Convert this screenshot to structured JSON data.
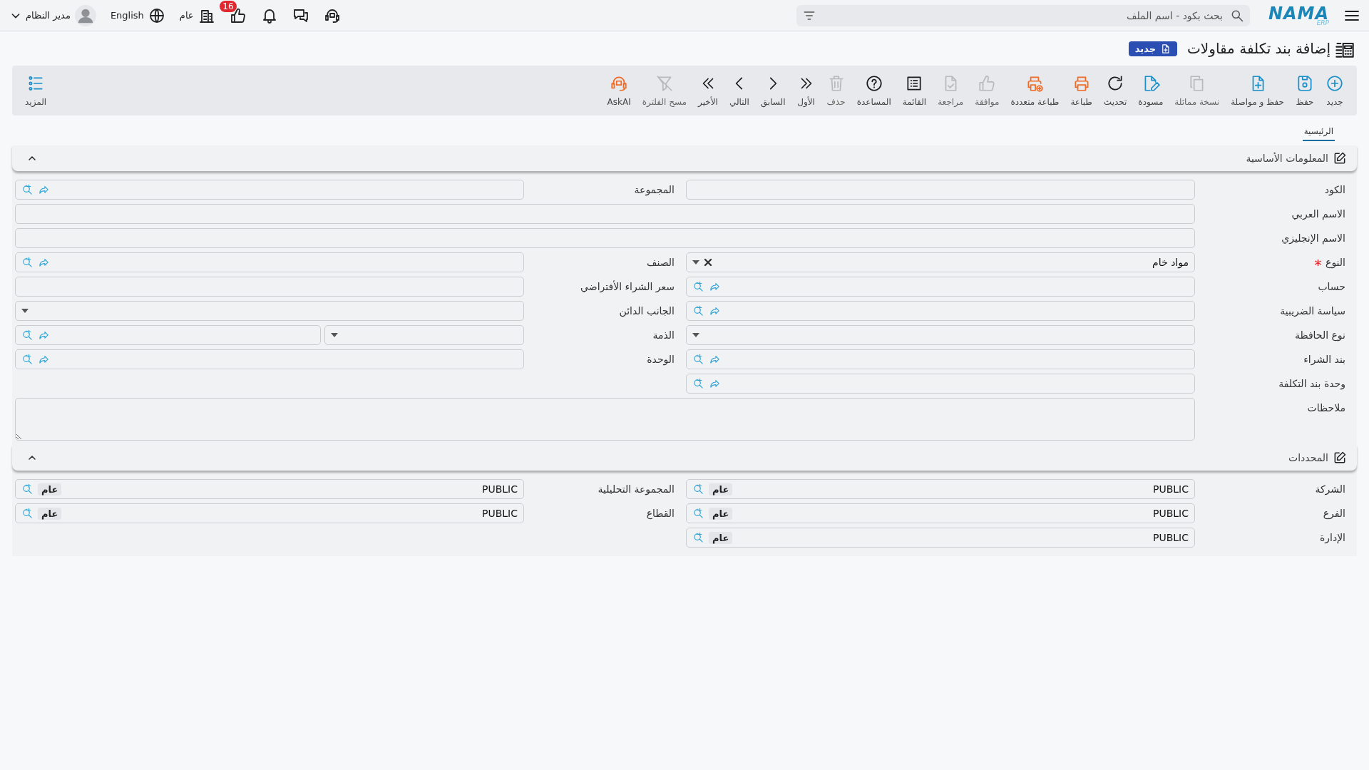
{
  "topbar": {
    "logo": {
      "name": "NAMA",
      "sub": "ERP"
    },
    "search": {
      "placeholder": "بحث بكود - اسم الملف"
    },
    "approvals_badge": "16",
    "scope": "عام",
    "language": "English",
    "user": "مدير النظام"
  },
  "page": {
    "title": "إضافة بند تكلفة مقاولات",
    "status": "جديد"
  },
  "toolbar": [
    {
      "label": "جديد",
      "kind": "new",
      "disabled": false
    },
    {
      "label": "حفظ",
      "kind": "save",
      "disabled": false
    },
    {
      "label": "حفظ و مواصلة",
      "kind": "save-continue",
      "disabled": false
    },
    {
      "label": "نسخة مماثلة",
      "kind": "copy",
      "disabled": true
    },
    {
      "label": "مسودة",
      "kind": "draft",
      "disabled": false
    },
    {
      "label": "تحديث",
      "kind": "refresh",
      "disabled": false
    },
    {
      "label": "طباعة",
      "kind": "print",
      "disabled": false
    },
    {
      "label": "طباعة متعددة",
      "kind": "multi-print",
      "disabled": false
    },
    {
      "label": "موافقة",
      "kind": "approve",
      "disabled": true
    },
    {
      "label": "مراجعة",
      "kind": "review",
      "disabled": true
    },
    {
      "label": "القائمة",
      "kind": "list",
      "disabled": false
    },
    {
      "label": "المساعدة",
      "kind": "help",
      "disabled": false
    },
    {
      "label": "حذف",
      "kind": "delete",
      "disabled": true
    },
    {
      "label": "الأول",
      "kind": "first",
      "disabled": false
    },
    {
      "label": "السابق",
      "kind": "prev",
      "disabled": false
    },
    {
      "label": "التالي",
      "kind": "next",
      "disabled": false
    },
    {
      "label": "الأخير",
      "kind": "last",
      "disabled": false
    },
    {
      "label": "مسح الفلترة",
      "kind": "clear-filter",
      "disabled": true
    },
    {
      "label": "AskAI",
      "kind": "askai",
      "disabled": false
    }
  ],
  "more": {
    "label": "المزيد"
  },
  "tabs": [
    {
      "label": "الرئيسية",
      "selected": true
    }
  ],
  "sections": [
    {
      "title": "المعلومات الأساسية",
      "expanded": true,
      "rows": [
        {
          "fields": [
            {
              "label": "الكود",
              "kind": "text",
              "required": false
            },
            {
              "label": "المجموعة",
              "kind": "lookup",
              "required": false
            }
          ]
        },
        {
          "fields": [
            {
              "label": "الاسم العربي",
              "kind": "wide",
              "required": false
            }
          ]
        },
        {
          "fields": [
            {
              "label": "الاسم الإنجليزي",
              "kind": "wide",
              "required": false
            }
          ]
        },
        {
          "fields": [
            {
              "label": "النوع",
              "kind": "select-clear",
              "value": "مواد خام",
              "required": true
            },
            {
              "label": "الصنف",
              "kind": "lookup",
              "required": false
            }
          ]
        },
        {
          "fields": [
            {
              "label": "حساب",
              "kind": "lookup",
              "required": false
            },
            {
              "label": "سعر الشراء الأفتراضي",
              "kind": "text",
              "required": false
            }
          ]
        },
        {
          "fields": [
            {
              "label": "سياسة الضريبية",
              "kind": "lookup",
              "required": false
            },
            {
              "label": "الجانب الدائن",
              "kind": "select",
              "required": false
            }
          ]
        },
        {
          "fields": [
            {
              "label": "نوع الحافظة",
              "kind": "select",
              "required": false
            },
            {
              "label": "الذمة",
              "kind": "split",
              "required": false
            }
          ]
        },
        {
          "fields": [
            {
              "label": "بند الشراء",
              "kind": "lookup",
              "required": false
            },
            {
              "label": "الوحدة",
              "kind": "lookup",
              "required": false
            }
          ]
        },
        {
          "fields": [
            {
              "label": "وحدة بند التكلفة",
              "kind": "lookup",
              "required": false
            }
          ]
        },
        {
          "fields": [
            {
              "label": "ملاحظات",
              "kind": "notes",
              "required": false
            }
          ]
        }
      ]
    },
    {
      "title": "المحددات",
      "expanded": true,
      "rows": [
        {
          "fields": [
            {
              "label": "الشركة",
              "kind": "public",
              "value": "PUBLIC",
              "tag": "عام",
              "required": false
            },
            {
              "label": "المجموعة التحليلية",
              "kind": "public",
              "value": "PUBLIC",
              "tag": "عام",
              "required": false
            }
          ]
        },
        {
          "fields": [
            {
              "label": "الفرع",
              "kind": "public",
              "value": "PUBLIC",
              "tag": "عام",
              "required": false
            },
            {
              "label": "القطاع",
              "kind": "public",
              "value": "PUBLIC",
              "tag": "عام",
              "required": false
            }
          ]
        },
        {
          "fields": [
            {
              "label": "الإدارة",
              "kind": "public",
              "value": "PUBLIC",
              "tag": "عام",
              "required": false
            }
          ]
        }
      ]
    }
  ]
}
